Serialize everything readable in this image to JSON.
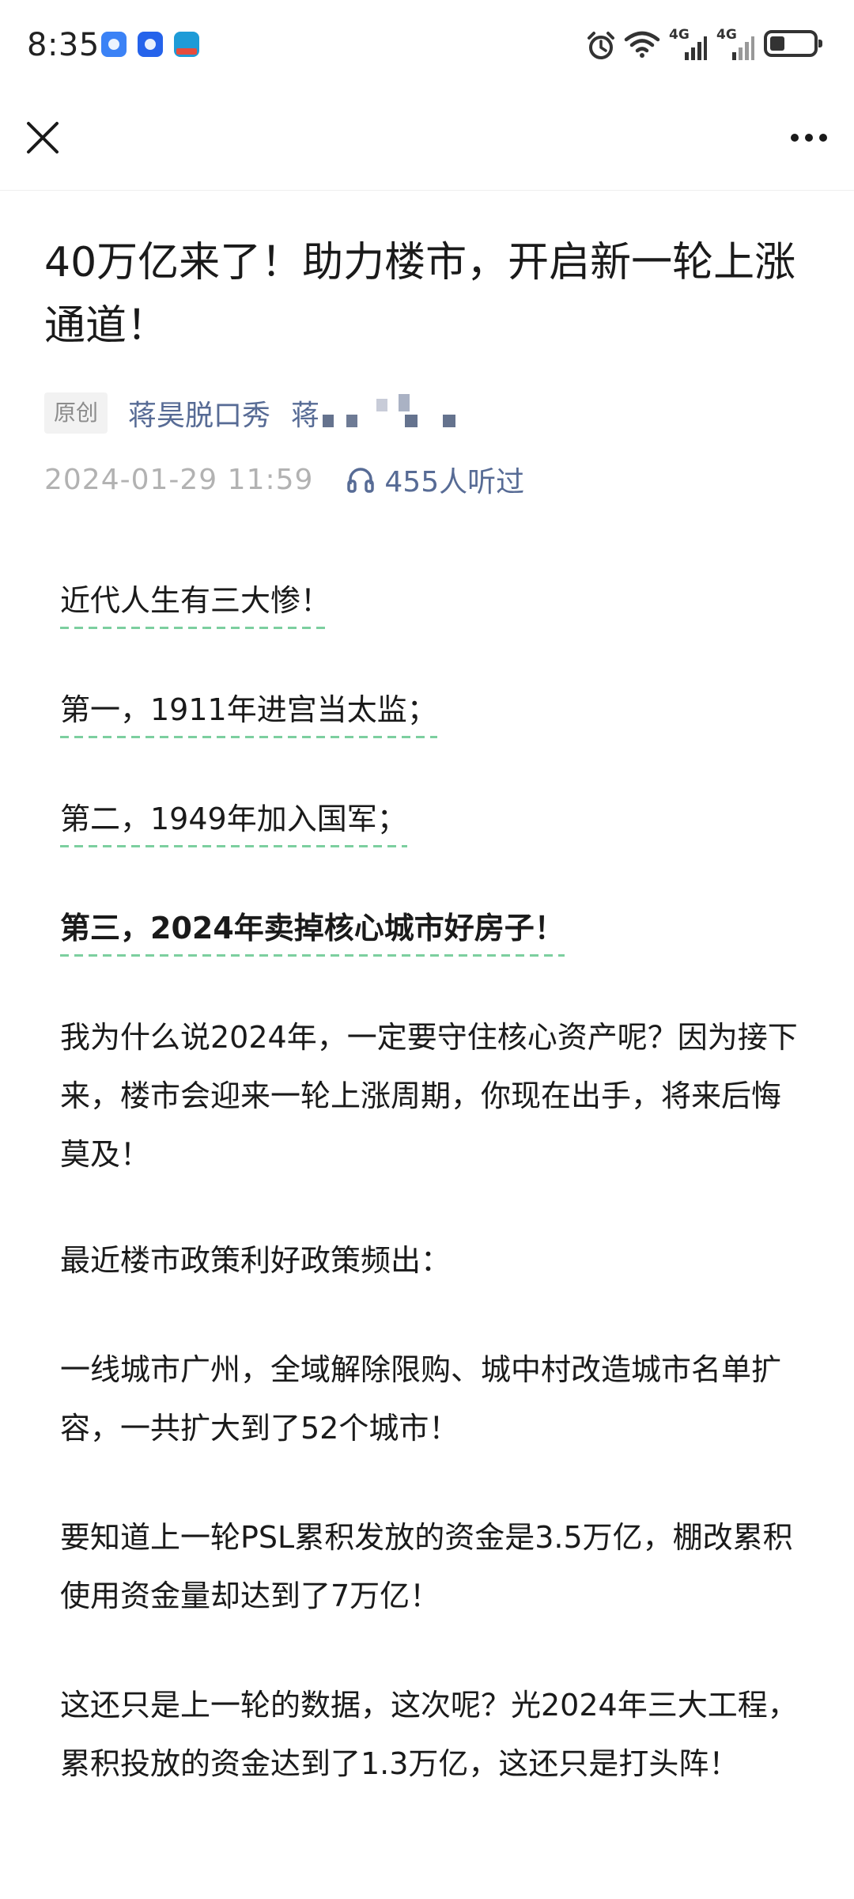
{
  "status_bar": {
    "time": "8:35",
    "network_1": "4G",
    "network_2": "4G"
  },
  "nav": {
    "close_icon": "close-icon",
    "more_icon": "more-icon"
  },
  "article": {
    "title": "40万亿来了！助力楼市，开启新一轮上涨通道！",
    "original_tag": "原创",
    "author": "蒋昊脱口秀",
    "account_prefix": "蒋",
    "publish_date": "2024-01-29 11:59",
    "listen_count": "455人听过",
    "paragraphs": [
      "近代人生有三大惨！",
      "第一，1911年进宫当太监；",
      "第二，1949年加入国军；",
      "第三，2024年卖掉核心城市好房子！",
      "我为什么说2024年，一定要守住核心资产呢？因为接下来，楼市会迎来一轮上涨周期，你现在出手，将来后悔莫及！",
      "最近楼市政策利好政策频出：",
      "一线城市广州，全域解除限购、城中村改造城市名单扩容，一共扩大到了52个城市！",
      "要知道上一轮PSL累积发放的资金是3.5万亿，棚改累积使用资金量却达到了7万亿！",
      "这还只是上一轮的数据，这次呢？光2024年三大工程，累积投放的资金达到了1.3万亿，这还只是打头阵！"
    ]
  },
  "colors": {
    "link": "#576b95",
    "meta_gray": "#b2b2b2",
    "underline_green": "#7ccf9f"
  }
}
